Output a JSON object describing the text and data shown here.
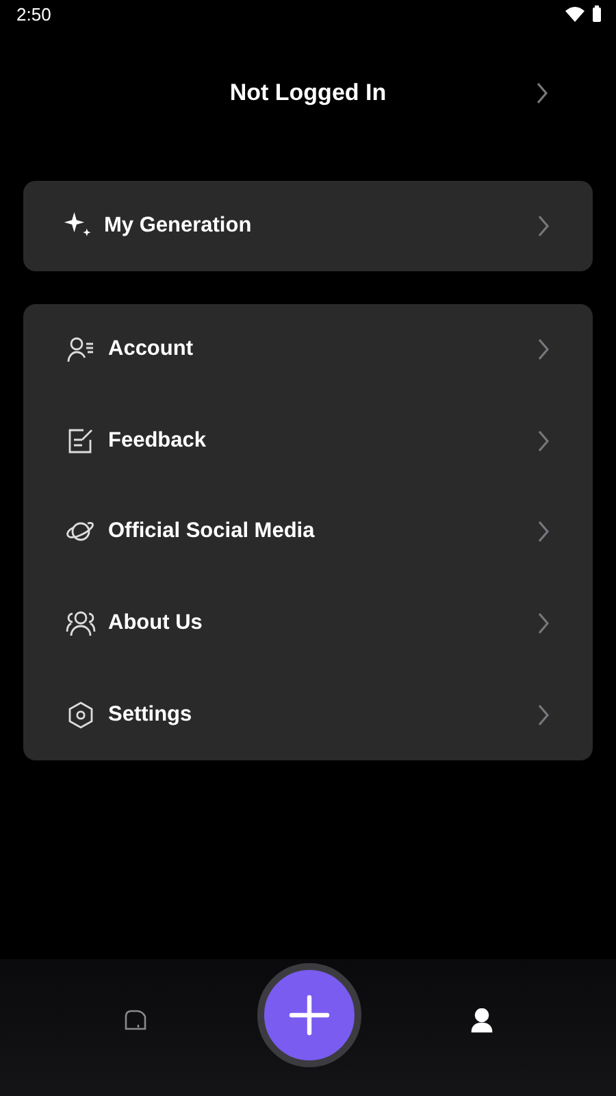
{
  "status_bar": {
    "time": "2:50"
  },
  "header": {
    "title": "Not Logged In"
  },
  "cards": [
    {
      "items": [
        {
          "kind": "sparkle",
          "label": "My Generation"
        }
      ]
    },
    {
      "items": [
        {
          "kind": "account",
          "label": "Account"
        },
        {
          "kind": "feedback",
          "label": "Feedback"
        },
        {
          "kind": "planet",
          "label": "Official Social Media"
        },
        {
          "kind": "people",
          "label": "About Us"
        },
        {
          "kind": "settings",
          "label": "Settings"
        }
      ]
    }
  ],
  "bottom_nav": {
    "tabs": [
      {
        "kind": "home",
        "selected": false
      },
      {
        "kind": "create",
        "selected": false
      },
      {
        "kind": "profile",
        "selected": true
      }
    ]
  }
}
